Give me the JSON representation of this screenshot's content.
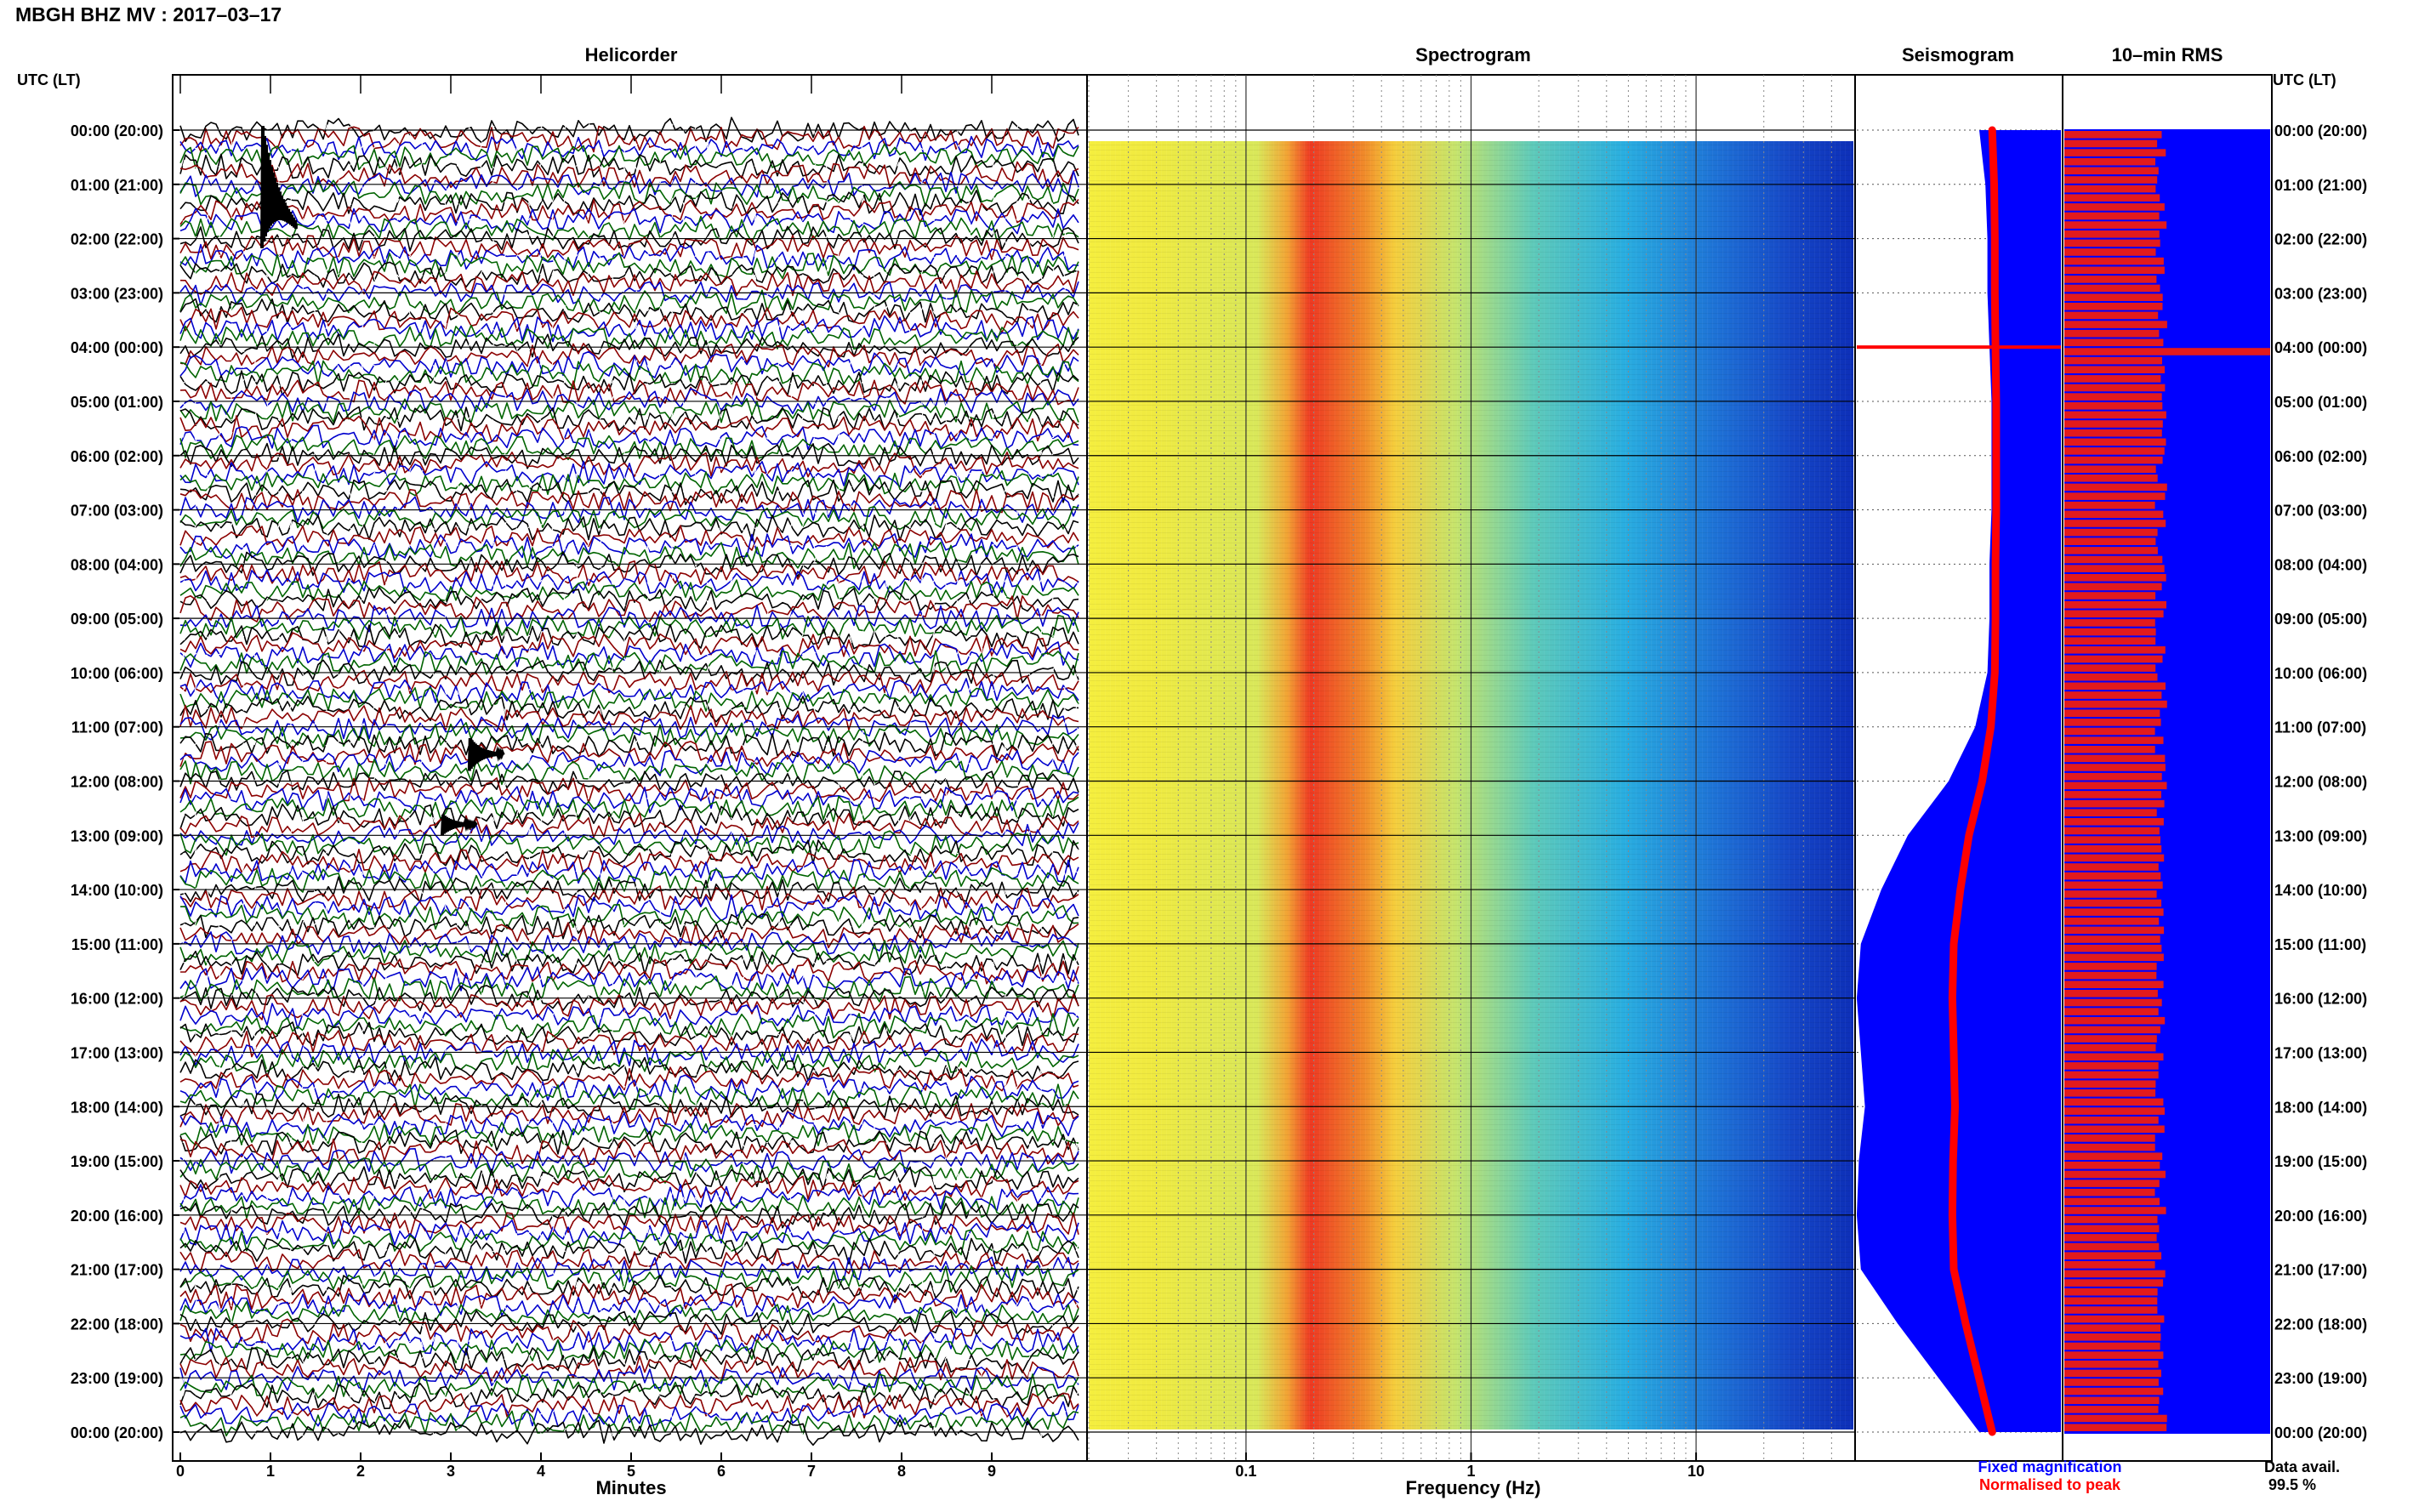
{
  "header": {
    "title": "MBGH BHZ MV : 2017–03–17"
  },
  "panels": {
    "helicorder": "Helicorder",
    "spectrogram": "Spectrogram",
    "seismogram": "Seismogram",
    "rms": "10–min RMS"
  },
  "axis_headers": {
    "left": "UTC (LT)",
    "right": "UTC (LT)"
  },
  "x_axes": {
    "helicorder_label": "Minutes",
    "helicorder_ticks": [
      "0",
      "1",
      "2",
      "3",
      "4",
      "5",
      "6",
      "7",
      "8",
      "9"
    ],
    "spectrogram_label": "Frequency (Hz)",
    "spectrogram_ticks": [
      "0.1",
      "1",
      "10"
    ]
  },
  "legend": {
    "fixed": "Fixed magnification",
    "normalised": "Normalised to peak",
    "fixed_color": "#0000ff",
    "normalised_color": "#ff0000"
  },
  "availability": {
    "label": "Data avail.",
    "value": "99.5 %"
  },
  "colors": {
    "trace_cycle": [
      "#000000",
      "#8b0000",
      "#0000cd",
      "#006400"
    ],
    "seismo_fill": "#0000ff",
    "seismo_peak": "#ff0000",
    "rms_bar": "#e31a1c",
    "rms_bg": "#0000ff"
  },
  "chart_data": [
    {
      "type": "line",
      "panel": "Helicorder",
      "xlabel": "Minutes",
      "xlim": [
        0,
        10
      ],
      "rows_per_hour": 6,
      "time_labels": [
        "00:00 (20:00)",
        "01:00 (21:00)",
        "02:00 (22:00)",
        "03:00 (23:00)",
        "04:00 (00:00)",
        "05:00 (01:00)",
        "06:00 (02:00)",
        "07:00 (03:00)",
        "08:00 (04:00)",
        "09:00 (05:00)",
        "10:00 (06:00)",
        "11:00 (07:00)",
        "12:00 (08:00)",
        "13:00 (09:00)",
        "14:00 (10:00)",
        "15:00 (11:00)",
        "16:00 (12:00)",
        "17:00 (13:00)",
        "18:00 (14:00)",
        "19:00 (15:00)",
        "20:00 (16:00)",
        "21:00 (17:00)",
        "22:00 (18:00)",
        "23:00 (19:00)",
        "00:00 (20:00)"
      ],
      "events": [
        {
          "utc_hour": 1.0,
          "minute": 1.0,
          "amplitude": "large"
        },
        {
          "utc_hour": 11.5,
          "minute": 3.3,
          "amplitude": "medium"
        },
        {
          "utc_hour": 12.8,
          "minute": 3.0,
          "amplitude": "small"
        }
      ]
    },
    {
      "type": "heatmap",
      "panel": "Spectrogram",
      "xlabel": "Frequency (Hz)",
      "xscale": "log",
      "xlim": [
        0.02,
        50
      ],
      "xticks": [
        0.1,
        1,
        10
      ],
      "peak_band_hz": [
        0.17,
        0.55
      ],
      "colormap": "jet"
    },
    {
      "type": "area",
      "panel": "Seismogram",
      "series": [
        {
          "name": "Fixed magnification",
          "color": "#0000ff"
        },
        {
          "name": "Normalised to peak",
          "color": "#ff0000"
        }
      ],
      "utc_hours": [
        0,
        1,
        2,
        3,
        4,
        5,
        6,
        7,
        8,
        9,
        10,
        11,
        12,
        13,
        14,
        15,
        16,
        17,
        18,
        19,
        20,
        21,
        22,
        23,
        24
      ],
      "fixed_amplitude": [
        0.4,
        0.37,
        0.36,
        0.36,
        0.35,
        0.34,
        0.34,
        0.34,
        0.35,
        0.35,
        0.36,
        0.42,
        0.55,
        0.75,
        0.88,
        0.98,
        1.0,
        0.98,
        0.96,
        0.99,
        1.0,
        0.98,
        0.8,
        0.6,
        0.4
      ],
      "peak_anomaly_utc_hour": 4.0
    },
    {
      "type": "bar",
      "panel": "10–min RMS",
      "orientation": "horizontal",
      "bars_per_hour": 6,
      "typical_value": 0.47,
      "spike_utc_hour": 4.0
    }
  ]
}
